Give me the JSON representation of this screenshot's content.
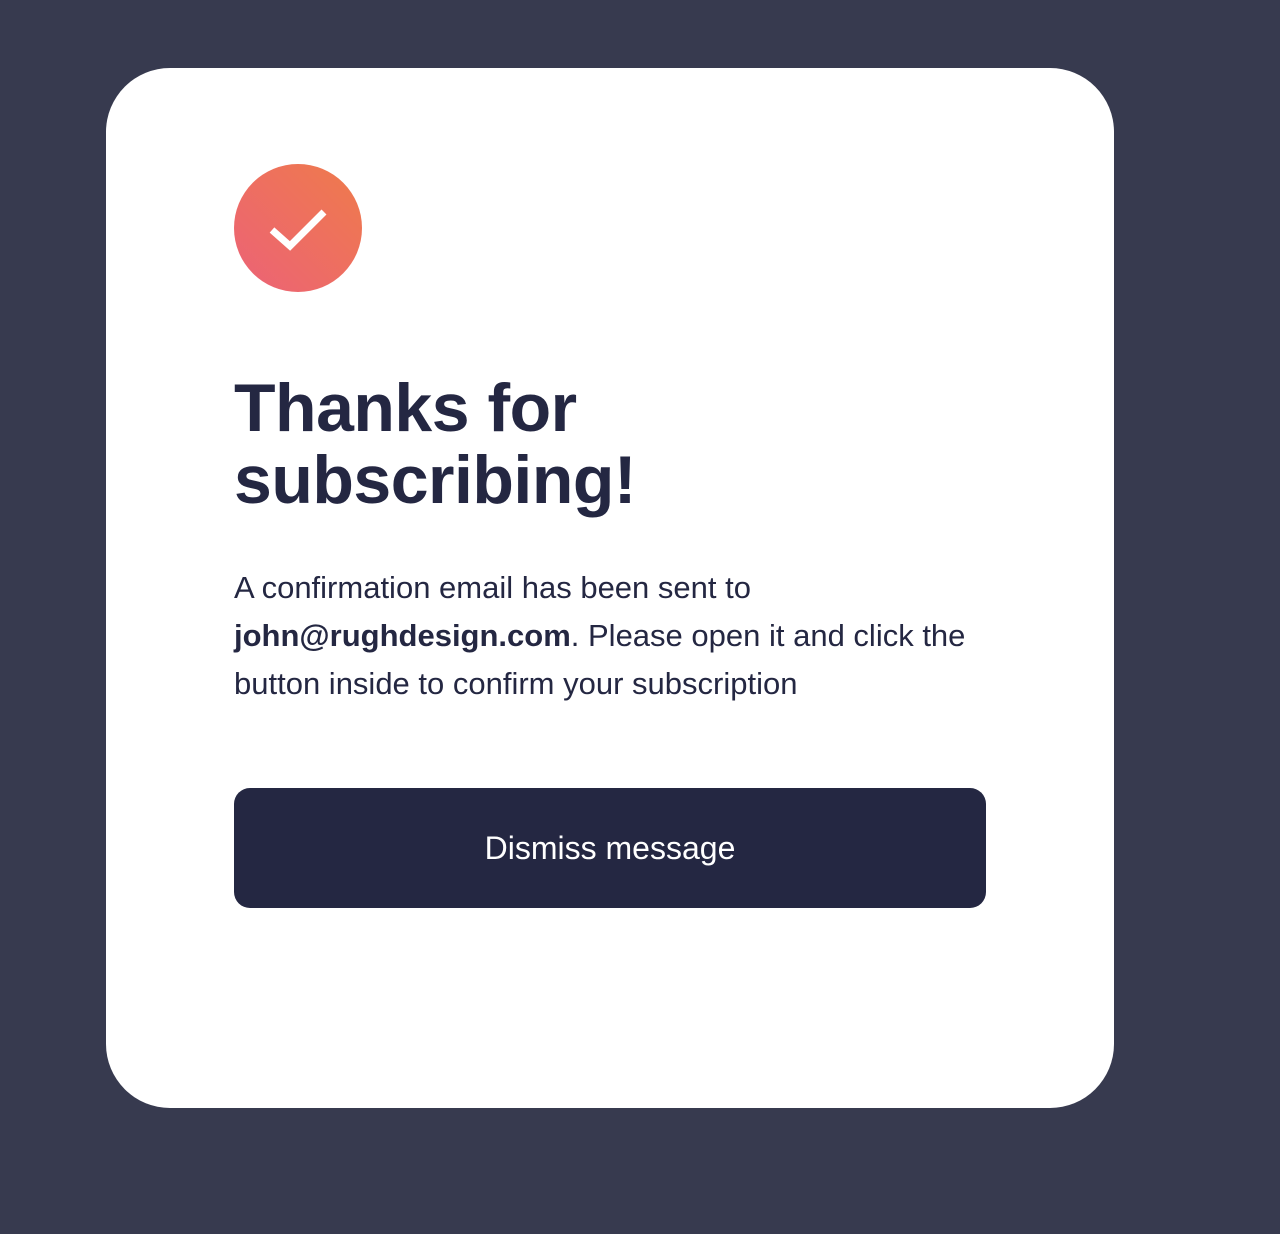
{
  "card": {
    "icon": "check-icon",
    "title": "Thanks for subscribing!",
    "message_prefix": "A confirmation email has been sent to ",
    "email": "john@rughdesign.com",
    "message_suffix": ". Please open it and click the button inside to confirm your subscription",
    "dismiss_label": "Dismiss message"
  },
  "colors": {
    "background": "#373a4f",
    "card": "#ffffff",
    "text": "#242742",
    "button": "#242742",
    "accent_start": "#ef7b4b",
    "accent_end": "#ec6277"
  }
}
